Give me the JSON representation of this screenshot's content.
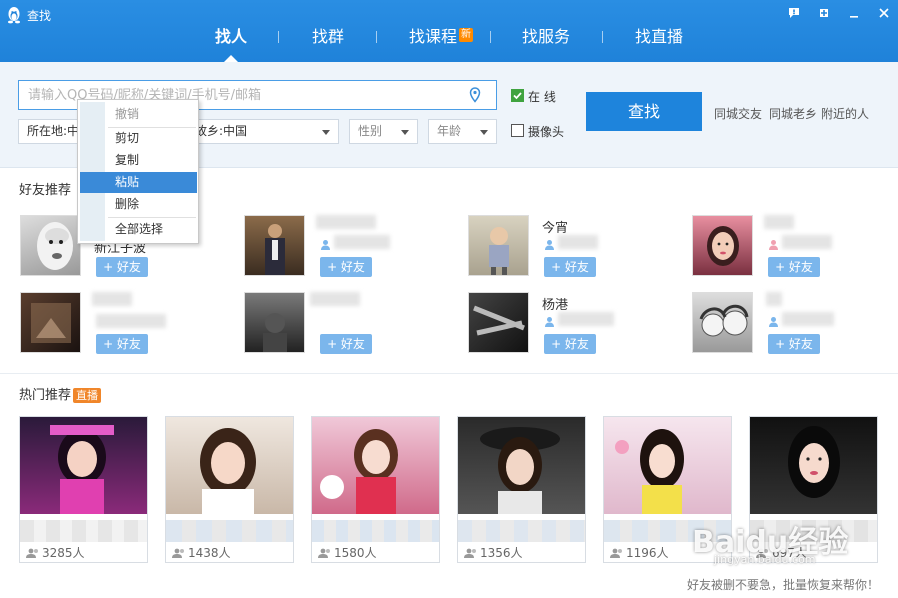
{
  "window": {
    "title": "查找",
    "title_icon": "qq-penguin-icon",
    "controls": [
      "feedback-icon",
      "skin-icon",
      "minimize-icon",
      "close-icon"
    ]
  },
  "nav": {
    "tabs": [
      {
        "label": "找人",
        "active": true
      },
      {
        "label": "找群",
        "active": false
      },
      {
        "label": "找课程",
        "active": false,
        "badge": "新"
      },
      {
        "label": "找服务",
        "active": false
      },
      {
        "label": "找直播",
        "active": false
      }
    ]
  },
  "search": {
    "placeholder": "请输入QQ号码/昵称/关键词/手机号/邮箱",
    "online_label": "在 线",
    "camera_label": "摄像头",
    "online_checked": true,
    "camera_checked": false,
    "location_label": "所在地:中",
    "hometown_label": "故乡:中国",
    "gender_label": "性别",
    "age_label": "年龄",
    "button_label": "查找",
    "quick_links": [
      "同城交友",
      "同城老乡",
      "附近的人"
    ]
  },
  "context_menu": {
    "items": [
      {
        "label": "撤销",
        "disabled": true
      },
      {
        "label": "剪切",
        "disabled": false
      },
      {
        "label": "复制",
        "disabled": false
      },
      {
        "label": "粘贴",
        "disabled": false,
        "highlighted": true
      },
      {
        "label": "删除",
        "disabled": false
      },
      {
        "label": "全部选择",
        "disabled": false
      }
    ]
  },
  "friends": {
    "title": "好友推荐",
    "add_label": "+ 好友",
    "items": [
      {
        "name": "",
        "sub": "新江子波"
      },
      {
        "name": "",
        "sub": ""
      },
      {
        "name": "今宵",
        "sub": ""
      },
      {
        "name": "",
        "sub": ""
      },
      {
        "name": "",
        "sub": ""
      },
      {
        "name": "",
        "sub": ""
      },
      {
        "name": "杨港",
        "sub": ""
      },
      {
        "name": "",
        "sub": ""
      }
    ]
  },
  "hot": {
    "title": "热门推荐",
    "badge": "直播",
    "items": [
      {
        "count": "3285人"
      },
      {
        "count": "1438人"
      },
      {
        "count": "1580人"
      },
      {
        "count": "1356人"
      },
      {
        "count": "1196人"
      },
      {
        "count": "697人"
      }
    ]
  },
  "footer": {
    "note": "好友被删不要急，批量恢复来帮你！"
  },
  "watermark": {
    "brand": "Baidu经验",
    "url": "jingyan.baidu.com"
  },
  "colors": {
    "title_bar": "#1f82d9",
    "accent": "#1e84dc",
    "new_badge": "#ff8a00",
    "live_badge": "#f0862a",
    "add_button": "#7bb6ec",
    "menu_highlight": "#3a8ad8"
  }
}
